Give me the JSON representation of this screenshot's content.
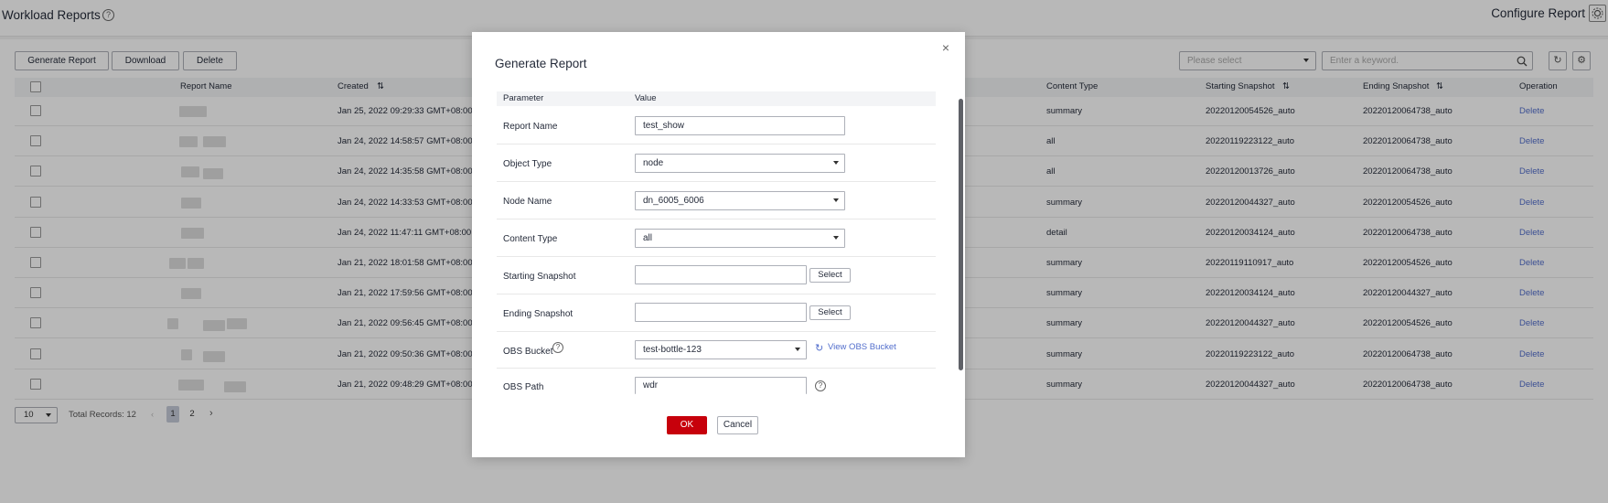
{
  "page": {
    "title": "Workload Reports",
    "configure_label": "Configure Report"
  },
  "toolbar": {
    "generate_label": "Generate Report",
    "download_label": "Download",
    "delete_label": "Delete",
    "select_placeholder": "Please select",
    "search_placeholder": "Enter a keyword."
  },
  "table": {
    "columns": [
      "Report Name",
      "Created",
      "Content Type",
      "Starting Snapshot",
      "Ending Snapshot",
      "Operation"
    ],
    "rows": [
      {
        "created": "Jan 25, 2022 09:29:33 GMT+08:00",
        "content": "summary",
        "start": "20220120054526_auto",
        "end": "20220120064738_auto",
        "op": "Delete"
      },
      {
        "created": "Jan 24, 2022 14:58:57 GMT+08:00",
        "content": "all",
        "start": "20220119223122_auto",
        "end": "20220120064738_auto",
        "op": "Delete"
      },
      {
        "created": "Jan 24, 2022 14:35:58 GMT+08:00",
        "content": "all",
        "start": "20220120013726_auto",
        "end": "20220120064738_auto",
        "op": "Delete"
      },
      {
        "created": "Jan 24, 2022 14:33:53 GMT+08:00",
        "content": "summary",
        "start": "20220120044327_auto",
        "end": "20220120054526_auto",
        "op": "Delete"
      },
      {
        "created": "Jan 24, 2022 11:47:11 GMT+08:00",
        "content": "detail",
        "start": "20220120034124_auto",
        "end": "20220120064738_auto",
        "op": "Delete"
      },
      {
        "created": "Jan 21, 2022 18:01:58 GMT+08:00",
        "content": "summary",
        "start": "20220119110917_auto",
        "end": "20220120054526_auto",
        "op": "Delete"
      },
      {
        "created": "Jan 21, 2022 17:59:56 GMT+08:00",
        "content": "summary",
        "start": "20220120034124_auto",
        "end": "20220120044327_auto",
        "op": "Delete"
      },
      {
        "created": "Jan 21, 2022 09:56:45 GMT+08:00",
        "content": "summary",
        "start": "20220120044327_auto",
        "end": "20220120054526_auto",
        "op": "Delete"
      },
      {
        "created": "Jan 21, 2022 09:50:36 GMT+08:00",
        "content": "summary",
        "start": "20220119223122_auto",
        "end": "20220120064738_auto",
        "op": "Delete"
      },
      {
        "created": "Jan 21, 2022 09:48:29 GMT+08:00",
        "content": "summary",
        "start": "20220120044327_auto",
        "end": "20220120064738_auto",
        "op": "Delete"
      }
    ]
  },
  "pager": {
    "size": "10",
    "total": "Total Records: 12",
    "pages": [
      "1",
      "2"
    ]
  },
  "modal": {
    "title": "Generate Report",
    "col_param": "Parameter",
    "col_value": "Value",
    "fields": {
      "report_name": {
        "label": "Report Name",
        "value": "test_show"
      },
      "object_type": {
        "label": "Object Type",
        "value": "node"
      },
      "node_name": {
        "label": "Node Name",
        "value": "dn_6005_6006"
      },
      "content_type": {
        "label": "Content Type",
        "value": "all"
      },
      "starting_snapshot": {
        "label": "Starting Snapshot",
        "value": "",
        "button": "Select"
      },
      "ending_snapshot": {
        "label": "Ending Snapshot",
        "value": "",
        "button": "Select"
      },
      "obs_bucket": {
        "label": "OBS Bucket",
        "value": "test-bottle-123",
        "link": "View OBS Bucket"
      },
      "obs_path": {
        "label": "OBS Path",
        "value": "wdr"
      }
    },
    "ok_label": "OK",
    "cancel_label": "Cancel"
  }
}
